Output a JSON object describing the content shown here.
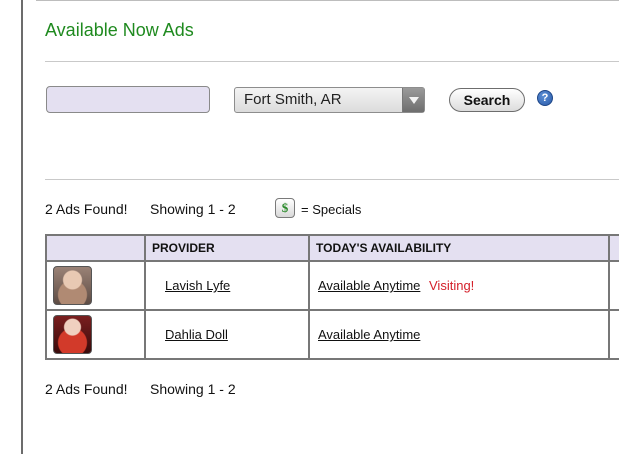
{
  "page": {
    "title": "Available Now Ads"
  },
  "search": {
    "input_value": "",
    "input_placeholder": "",
    "location_selected": "Fort Smith, AR",
    "button_label": "Search",
    "help_icon": "help-icon",
    "help_glyph": "?"
  },
  "results": {
    "ads_found": "2 Ads Found!",
    "showing": "Showing 1 - 2",
    "specials_badge": "$",
    "specials_label": "= Specials"
  },
  "table": {
    "headers": [
      "",
      "PROVIDER",
      "TODAY'S AVAILABILITY",
      ""
    ],
    "rows": [
      {
        "provider": "Lavish Lyfe",
        "availability": "Available Anytime",
        "badge": "Visiting!",
        "thumb": "provider-photo"
      },
      {
        "provider": "Dahlia Doll",
        "availability": "Available Anytime",
        "badge": "",
        "thumb": "provider-photo"
      }
    ]
  },
  "footer": {
    "ads_found": "2 Ads Found!",
    "showing": "Showing 1 - 2"
  },
  "colors": {
    "title_green": "#1f8a1f",
    "header_lavender": "#e4e0f1",
    "visiting_red": "#d4202a"
  }
}
